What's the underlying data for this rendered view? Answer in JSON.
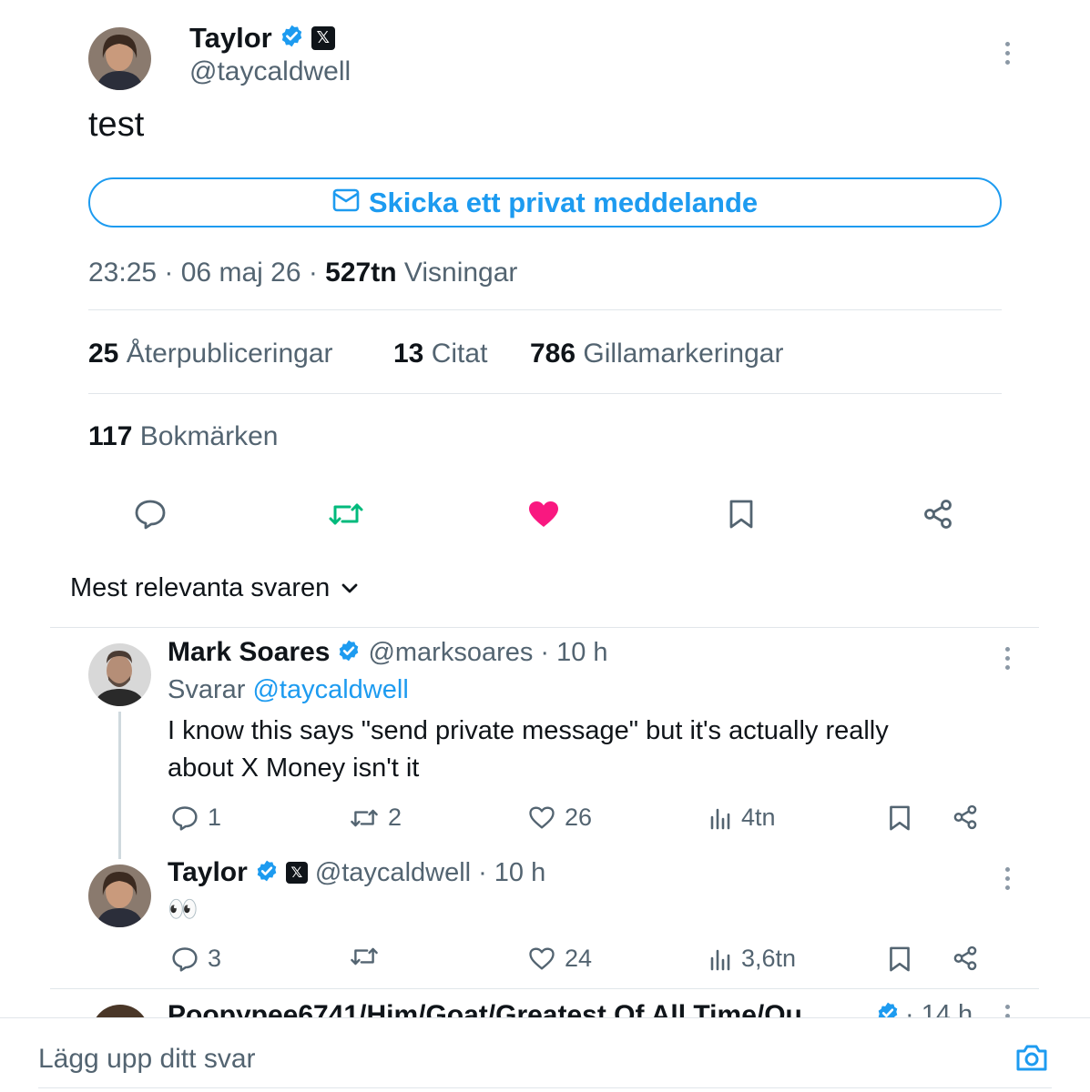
{
  "tweet": {
    "author": {
      "name": "Taylor",
      "handle": "@taycaldwell"
    },
    "text": "test",
    "dm_button_label": "Skicka ett privat meddelande",
    "time": "23:25",
    "date": "06 maj 26",
    "views_count": "527tn",
    "views_label": "Visningar",
    "stats": {
      "reposts_count": "25",
      "reposts_label": "Återpubliceringar",
      "quotes_count": "13",
      "quotes_label": "Citat",
      "likes_count": "786",
      "likes_label": "Gillamarkeringar",
      "bookmarks_count": "117",
      "bookmarks_label": "Bokmärken"
    }
  },
  "sort_label": "Mest relevanta svaren",
  "replies": [
    {
      "name": "Mark Soares",
      "handle": "@marksoares",
      "time": "· 10 h",
      "replying_prefix": "Svarar",
      "replying_to": "@taycaldwell",
      "text_line1": "I know this says \"send private message\" but it's actually really",
      "text_line2": "about X Money isn't it",
      "replies": "1",
      "reposts": "2",
      "likes": "26",
      "views": "4tn"
    },
    {
      "name": "Taylor",
      "handle": "@taycaldwell",
      "time": "· 10 h",
      "text": "👀",
      "replies": "3",
      "reposts": "",
      "likes": "24",
      "views": "3,6tn"
    },
    {
      "name": "Poopypee6741/Him/Goat/Greatest Of All Time/Ou",
      "time": "· 14 h"
    }
  ],
  "composer": {
    "placeholder": "Lägg upp ditt svar"
  },
  "colors": {
    "accent": "#1d9bf0",
    "like": "#f91880",
    "repost": "#00ba7c",
    "text": "#0f1419",
    "muted": "#536471"
  }
}
